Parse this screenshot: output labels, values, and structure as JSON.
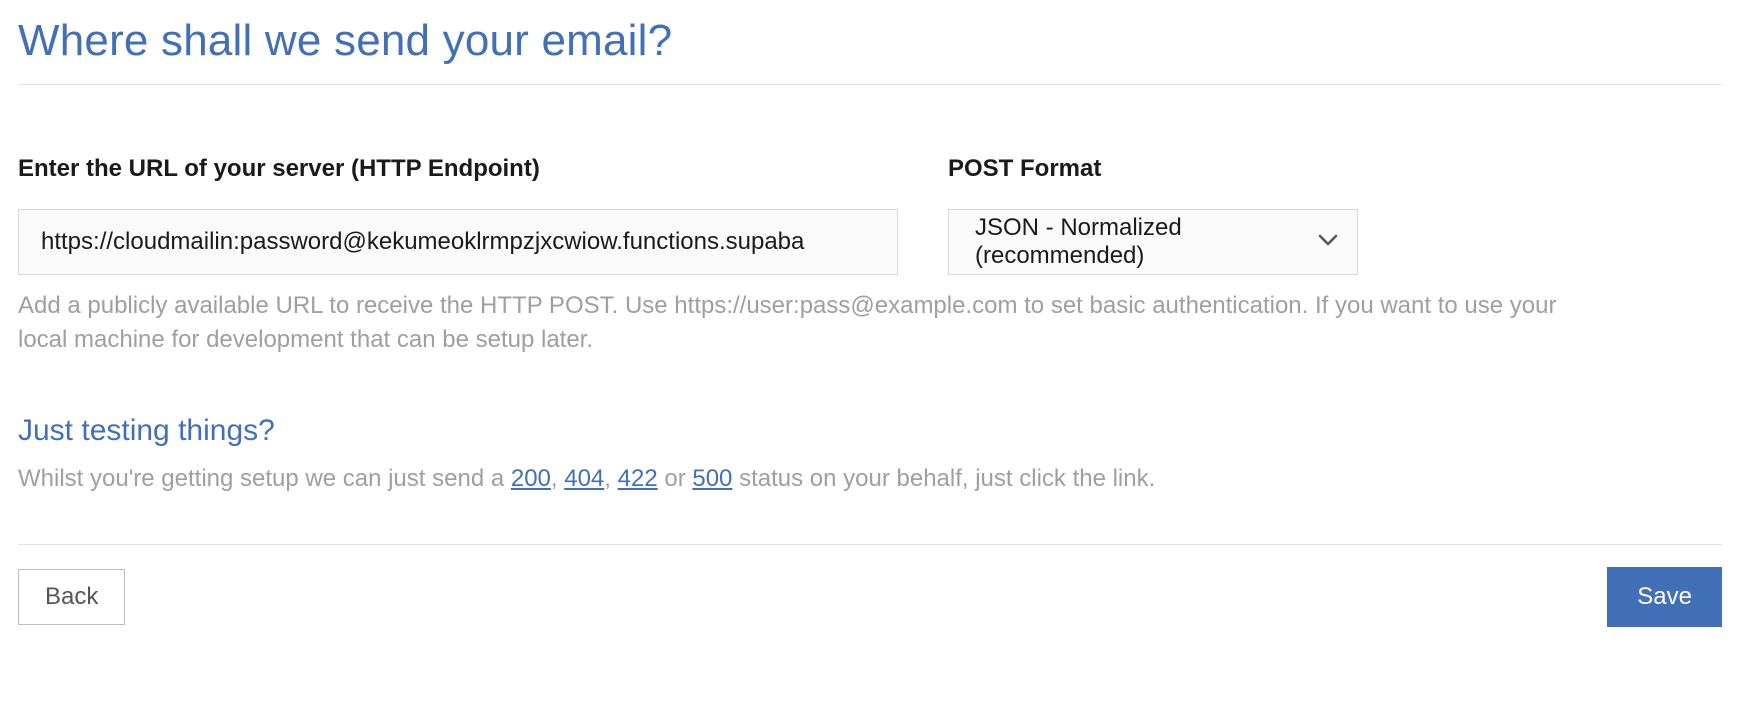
{
  "heading": "Where shall we send your email?",
  "url_field": {
    "label": "Enter the URL of your server (HTTP Endpoint)",
    "value": "https://cloudmailin:password@kekumeoklrmpzjxcwiow.functions.supaba"
  },
  "format_field": {
    "label": "POST Format",
    "selected": "JSON - Normalized (recommended)"
  },
  "help_text": "Add a publicly available URL to receive the HTTP POST. Use https://user:pass@example.com to set basic authentication. If you want to use your local machine for development that can be setup later.",
  "testing": {
    "heading": "Just testing things?",
    "prefix": "Whilst you're getting setup we can just send a ",
    "link_200": "200",
    "sep1": ", ",
    "link_404": "404",
    "sep2": ", ",
    "link_422": "422",
    "sep3": " or ",
    "link_500": "500",
    "suffix": " status on your behalf, just click the link."
  },
  "buttons": {
    "back": "Back",
    "save": "Save"
  }
}
